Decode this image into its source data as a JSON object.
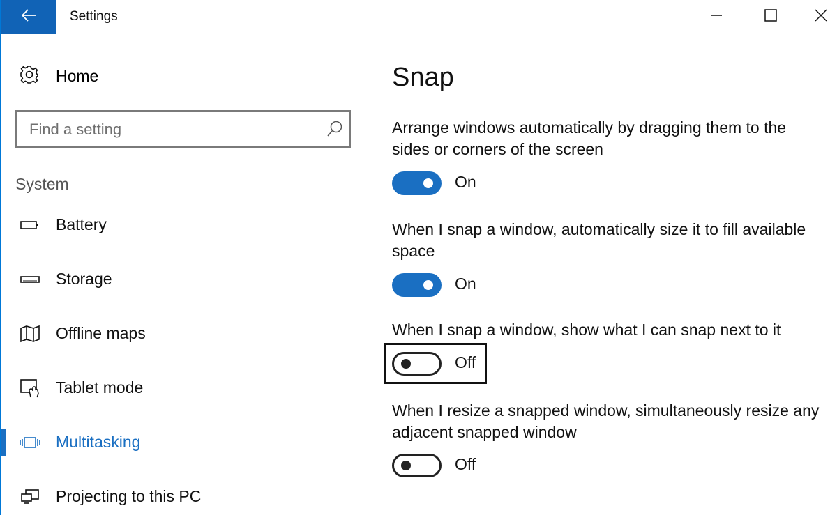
{
  "titlebar": {
    "title": "Settings",
    "back_icon": "back-arrow-icon",
    "minimize_icon": "minimize-icon",
    "maximize_icon": "maximize-icon",
    "close_icon": "close-icon"
  },
  "colors": {
    "accent": "#1a6fc2",
    "back_button_bg": "#1163b6",
    "text": "#111111",
    "section_label": "#555555"
  },
  "sidebar": {
    "home": {
      "label": "Home",
      "icon": "gear-icon"
    },
    "search": {
      "placeholder": "Find a setting",
      "icon": "search-icon"
    },
    "section": "System",
    "items": [
      {
        "label": "Battery",
        "icon": "battery-icon",
        "active": false
      },
      {
        "label": "Storage",
        "icon": "storage-icon",
        "active": false
      },
      {
        "label": "Offline maps",
        "icon": "map-icon",
        "active": false
      },
      {
        "label": "Tablet mode",
        "icon": "tablet-mode-icon",
        "active": false
      },
      {
        "label": "Multitasking",
        "icon": "multitasking-icon",
        "active": true
      },
      {
        "label": "Projecting to this PC",
        "icon": "projecting-icon",
        "active": false
      }
    ]
  },
  "main": {
    "title": "Snap",
    "settings": [
      {
        "description": "Arrange windows automatically by dragging them to the sides or corners of the screen",
        "state": "On"
      },
      {
        "description": "When I snap a window, automatically size it to fill available space",
        "state": "On"
      },
      {
        "description": "When I snap a window, show what I can snap next to it",
        "state": "Off"
      },
      {
        "description": "When I resize a snapped window, simultaneously resize any adjacent snapped window",
        "state": "Off"
      }
    ]
  }
}
